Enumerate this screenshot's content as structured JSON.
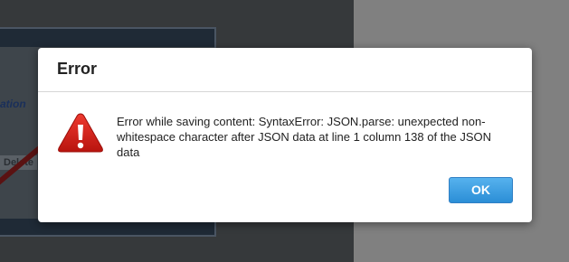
{
  "background": {
    "link_fragment": "ation",
    "delete_fragment": "Delete"
  },
  "dialog": {
    "title": "Error",
    "icon": "warning-icon",
    "message": "Error while saving content: SyntaxError: JSON.parse: unexpected non-whitespace character after JSON data at line 1 column 138 of the JSON data",
    "ok_label": "OK"
  },
  "colors": {
    "warning_red": "#d9231c",
    "ok_button": "#3d9fe2",
    "overlay_dark": "#36393b",
    "overlay_light": "#808080"
  }
}
